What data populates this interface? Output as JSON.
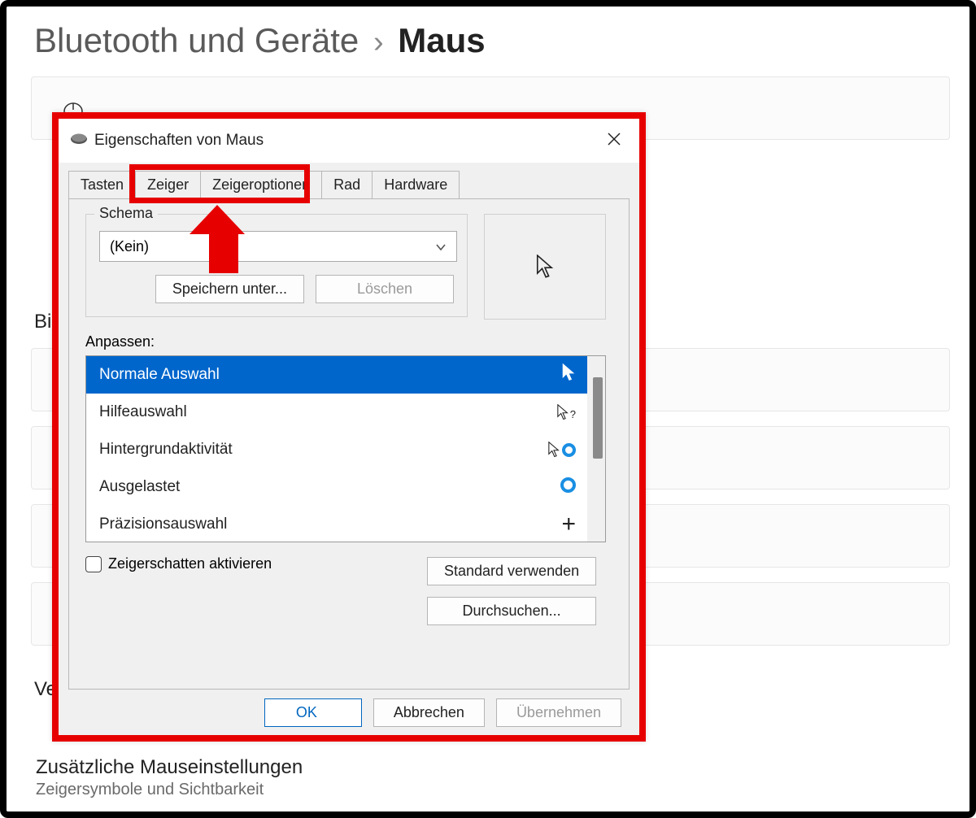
{
  "breadcrumb": {
    "parent": "Bluetooth und Geräte",
    "separator": "›",
    "current": "Maus"
  },
  "background": {
    "section1_partial": "Bi",
    "section2_partial": "Ve",
    "footer_title": "Zusätzliche Mauseinstellungen",
    "footer_sub": "Zeigersymbole und Sichtbarkeit"
  },
  "dialog": {
    "title": "Eigenschaften von Maus",
    "tabs": [
      "Tasten",
      "Zeiger",
      "Zeigeroptionen",
      "Rad",
      "Hardware"
    ],
    "active_tab_index": 1,
    "schema": {
      "legend": "Schema",
      "value": "(Kein)",
      "save_as": "Speichern unter...",
      "delete": "Löschen"
    },
    "customize_label": "Anpassen:",
    "cursors": [
      {
        "label": "Normale Auswahl",
        "icon": "arrow",
        "selected": true
      },
      {
        "label": "Hilfeauswahl",
        "icon": "help",
        "selected": false
      },
      {
        "label": "Hintergrundaktivität",
        "icon": "busy-bg",
        "selected": false
      },
      {
        "label": "Ausgelastet",
        "icon": "busy",
        "selected": false
      },
      {
        "label": "Präzisionsauswahl",
        "icon": "cross",
        "selected": false
      }
    ],
    "shadow_checkbox": "Zeigerschatten aktivieren",
    "use_default": "Standard verwenden",
    "browse": "Durchsuchen...",
    "ok": "OK",
    "cancel": "Abbrechen",
    "apply": "Übernehmen"
  }
}
